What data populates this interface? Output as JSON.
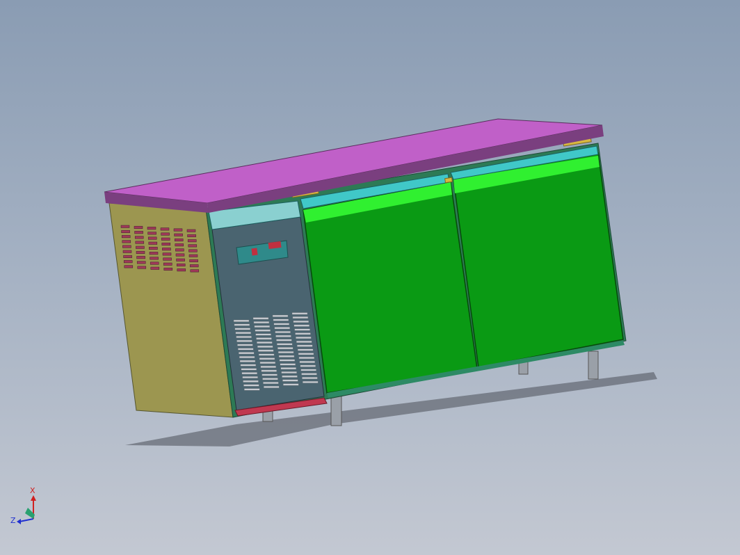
{
  "viewport": {
    "background_top": "#8a9cb3",
    "background_bottom": "#c3c8d2"
  },
  "model": {
    "colors": {
      "countertop": "#c060c8",
      "countertop_edge": "#7a3f7f",
      "side_panel": "#9c9650",
      "compressor_panel": "#4a6470",
      "door": "#0a9a14",
      "door_highlight": "#30f030",
      "door_rail": "#40c8c8",
      "hinge": "#d8b840",
      "kick_strip": "#c03850",
      "leg": "#9aa0a8"
    },
    "controller_display": "#c03040",
    "door_count": 2,
    "leg_count": 4
  },
  "triad": {
    "x_label": "X",
    "z_label": "Z",
    "x_color": "#d02020",
    "z_color": "#2030d0"
  }
}
